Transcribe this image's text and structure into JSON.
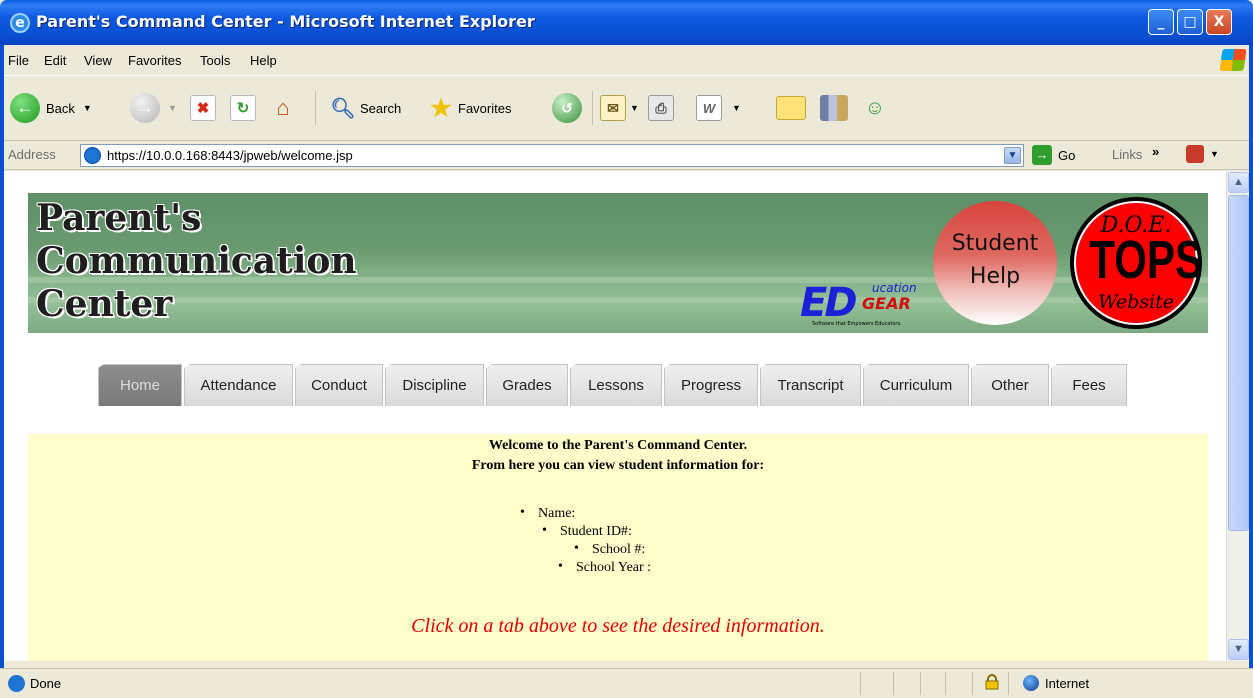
{
  "window": {
    "title": "Parent's Command Center - Microsoft Internet Explorer",
    "minimize": "_",
    "restore": "□",
    "close": "X"
  },
  "menu": [
    "File",
    "Edit",
    "View",
    "Favorites",
    "Tools",
    "Help"
  ],
  "toolbar": {
    "back_label": "Back",
    "search_label": "Search",
    "favorites_label": "Favorites"
  },
  "address": {
    "label": "Address",
    "url": "https://10.0.0.168:8443/jpweb/welcome.jsp",
    "go_label": "Go",
    "links_label": "Links"
  },
  "banner": {
    "title": "Parent's\nCommunication\nCenter",
    "student_help_line1": "Student",
    "student_help_line2": "Help",
    "tops_top": "D.O.E.",
    "tops_main": "TOPS",
    "tops_bottom": "Website",
    "edu_ed": "ED",
    "edu_ucation": "ucation",
    "edu_gear": "GEAR",
    "edu_tagline": "Software that Empowers Educators."
  },
  "tabs": [
    "Home",
    "Attendance",
    "Conduct",
    "Discipline",
    "Grades",
    "Lessons",
    "Progress",
    "Transcript",
    "Curriculum",
    "Other",
    "Fees"
  ],
  "active_tab": "Home",
  "content": {
    "welcome_line1": "Welcome to the Parent's Command Center.",
    "welcome_line2": "From here you can view student information for:",
    "name_label": "Name:",
    "student_id_label": "Student ID#:",
    "school_label": "School #:",
    "school_year_label": "School Year :",
    "hint": "Click on a tab above to see the desired information."
  },
  "status": {
    "text": "Done",
    "zone": "Internet"
  },
  "colors": {
    "hint": "#E00000",
    "content_bg": "#FFFFCC",
    "banner_green": "#6A9A70",
    "active_tab": "#808080"
  },
  "icons": [
    "ie-logo-icon",
    "back-arrow-icon",
    "forward-arrow-icon",
    "stop-icon",
    "refresh-icon",
    "home-icon",
    "search-icon",
    "favorites-star-icon",
    "history-icon",
    "mail-icon",
    "print-icon",
    "edit-word-icon",
    "discuss-icon",
    "research-icon",
    "messenger-icon",
    "go-arrow-icon",
    "lock-icon",
    "internet-globe-icon"
  ]
}
